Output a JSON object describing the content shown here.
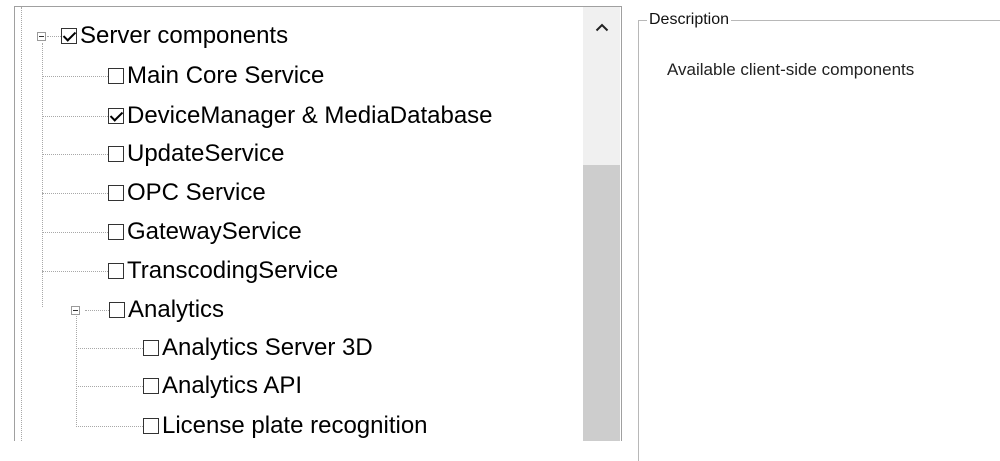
{
  "tree": {
    "nodes": [
      {
        "label": "Server components",
        "checked": true,
        "level": 0,
        "expanded": true
      },
      {
        "label": "Main Core Service",
        "checked": false,
        "level": 1
      },
      {
        "label": "DeviceManager & MediaDatabase",
        "checked": true,
        "level": 1
      },
      {
        "label": "UpdateService",
        "checked": false,
        "level": 1
      },
      {
        "label": "OPC Service",
        "checked": false,
        "level": 1
      },
      {
        "label": "GatewayService",
        "checked": false,
        "level": 1
      },
      {
        "label": "TranscodingService",
        "checked": false,
        "level": 1
      },
      {
        "label": "Analytics",
        "checked": false,
        "level": 1,
        "expanded": true
      },
      {
        "label": "Analytics Server 3D",
        "checked": false,
        "level": 2
      },
      {
        "label": "Analytics API",
        "checked": false,
        "level": 2
      },
      {
        "label": "License plate recognition",
        "checked": false,
        "level": 2
      }
    ]
  },
  "scrollbar": {
    "up_icon": "chevron-up-icon"
  },
  "description": {
    "title": "Description",
    "text": "Available client-side components"
  }
}
